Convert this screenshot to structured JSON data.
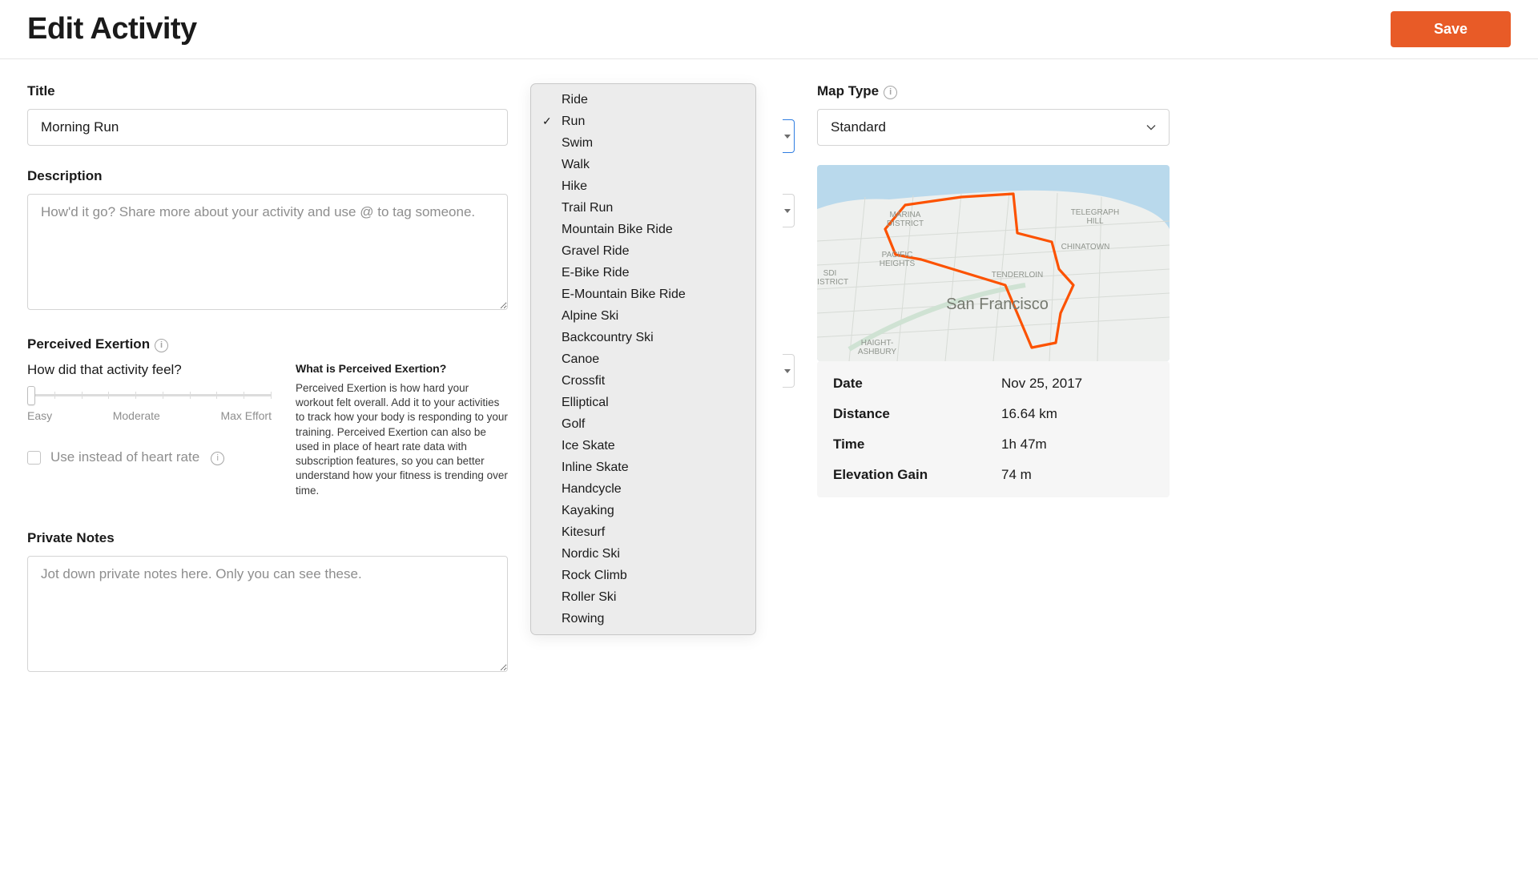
{
  "header": {
    "title": "Edit Activity",
    "save_label": "Save"
  },
  "left": {
    "title_label": "Title",
    "title_value": "Morning Run",
    "description_label": "Description",
    "description_placeholder": "How'd it go? Share more about your activity and use @ to tag someone.",
    "pe_label": "Perceived Exertion",
    "pe_question": "How did that activity feel?",
    "pe_scale": {
      "min": "Easy",
      "mid": "Moderate",
      "max": "Max Effort"
    },
    "hr_checkbox_label": "Use instead of heart rate",
    "pe_help_title": "What is Perceived Exertion?",
    "pe_help_body": "Perceived Exertion is how hard your workout felt overall. Add it to your activities to track how your body is responding to your training. Perceived Exertion can also be used in place of heart rate data with subscription features, so you can better understand how your fitness is trending over time.",
    "notes_label": "Private Notes",
    "notes_placeholder": "Jot down private notes here. Only you can see these."
  },
  "sport_dropdown": {
    "selected": "Run",
    "options": [
      "Ride",
      "Run",
      "Swim",
      "Walk",
      "Hike",
      "Trail Run",
      "Mountain Bike Ride",
      "Gravel Ride",
      "E-Bike Ride",
      "E-Mountain Bike Ride",
      "Alpine Ski",
      "Backcountry Ski",
      "Canoe",
      "Crossfit",
      "Elliptical",
      "Golf",
      "Ice Skate",
      "Inline Skate",
      "Handcycle",
      "Kayaking",
      "Kitesurf",
      "Nordic Ski",
      "Rock Climb",
      "Roller Ski",
      "Rowing"
    ]
  },
  "right": {
    "map_type_label": "Map Type",
    "map_type_value": "Standard",
    "map_center_label": "San Francisco",
    "map_areas": {
      "marina": "MARINA\nDISTRICT",
      "telegraph": "TELEGRAPH\nHILL",
      "pacific": "PACIFIC\nHEIGHTS",
      "chinatown": "CHINATOWN",
      "tenderloin": "TENDERLOIN",
      "sdi": "SDI\nDISTRICT",
      "haight": "HAIGHT-\nASHBURY"
    },
    "stats": {
      "date_k": "Date",
      "date_v": "Nov 25, 2017",
      "distance_k": "Distance",
      "distance_v": "16.64 km",
      "time_k": "Time",
      "time_v": "1h 47m",
      "elev_k": "Elevation Gain",
      "elev_v": "74 m"
    }
  }
}
